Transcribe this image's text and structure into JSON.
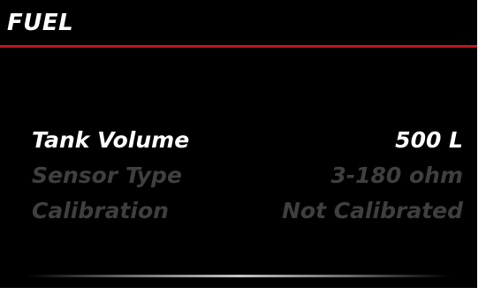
{
  "header": {
    "title": "FUEL"
  },
  "colors": {
    "background": "#000000",
    "accent": "#c0161e",
    "active_text": "#ffffff",
    "inactive_text": "#3f3f3f"
  },
  "settings": [
    {
      "label": "Tank Volume",
      "value": "500 L",
      "state": "selected"
    },
    {
      "label": "Sensor Type",
      "value": "3-180 ohm",
      "state": "unselected"
    },
    {
      "label": "Calibration",
      "value": "Not Calibrated",
      "state": "unselected"
    }
  ]
}
